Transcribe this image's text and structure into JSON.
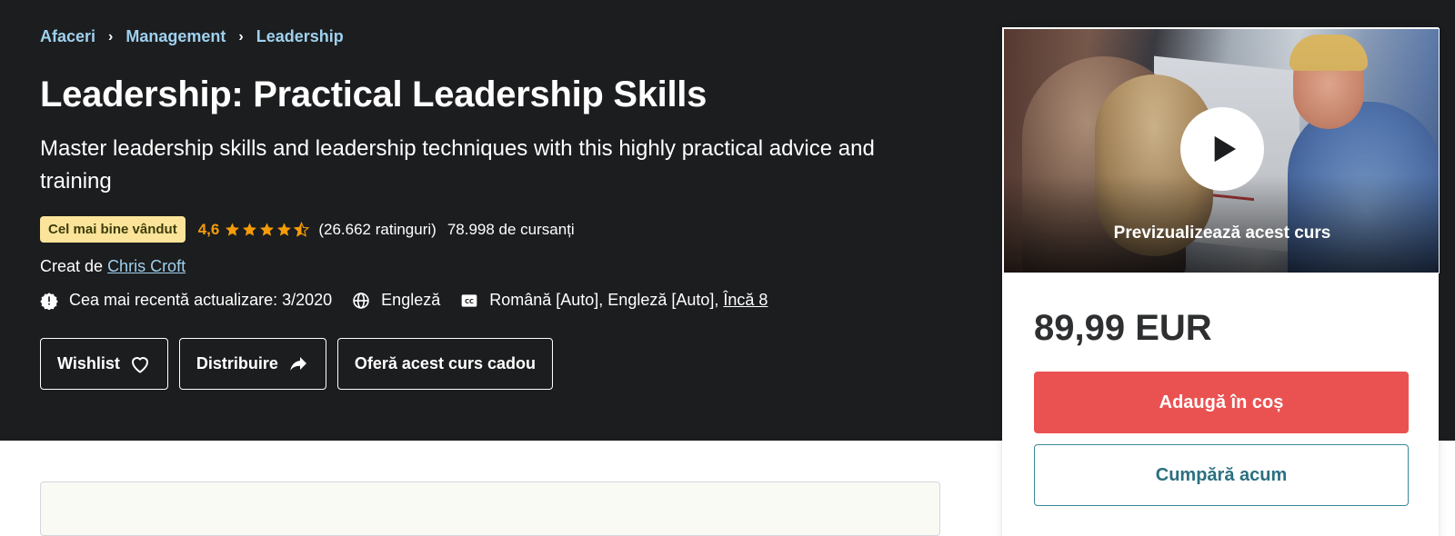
{
  "breadcrumb": {
    "items": [
      "Afaceri",
      "Management",
      "Leadership"
    ],
    "separator": "›"
  },
  "course": {
    "title": "Leadership: Practical Leadership Skills",
    "subtitle": "Master leadership skills and leadership techniques with this highly practical advice and training",
    "badge": "Cel mai bine vândut",
    "rating": "4,6",
    "rating_value": 4.6,
    "ratings_count": "(26.662 ratinguri)",
    "students": "78.998 de cursanți",
    "created_by_label": "Creat de",
    "instructor": "Chris Croft",
    "last_updated": "Cea mai recentă actualizare: 3/2020",
    "language": "Engleză",
    "captions": "Română [Auto], Engleză [Auto],",
    "captions_more": "Încă 8"
  },
  "actions": {
    "wishlist": "Wishlist",
    "share": "Distribuire",
    "gift": "Oferă acest curs cadou"
  },
  "sidebar": {
    "preview_label": "Previzualizează acest curs",
    "price": "89,99 EUR",
    "add_to_cart": "Adaugă în coș",
    "buy_now": "Cumpără acum"
  },
  "icons": {
    "breadcrumb_separator": "chevron-right-icon",
    "star": "star-icon",
    "update": "alert-badge-icon",
    "language": "globe-icon",
    "captions": "closed-captions-icon",
    "wishlist": "heart-icon",
    "share": "share-arrow-icon",
    "play": "play-icon"
  },
  "colors": {
    "hero_bg": "#1c1d1f",
    "breadcrumb_link": "#9fd1ee",
    "rating": "#f69c08",
    "badge_bg": "#fbe49a",
    "cart_button": "#ea5252",
    "buy_button_text": "#2b7080"
  }
}
